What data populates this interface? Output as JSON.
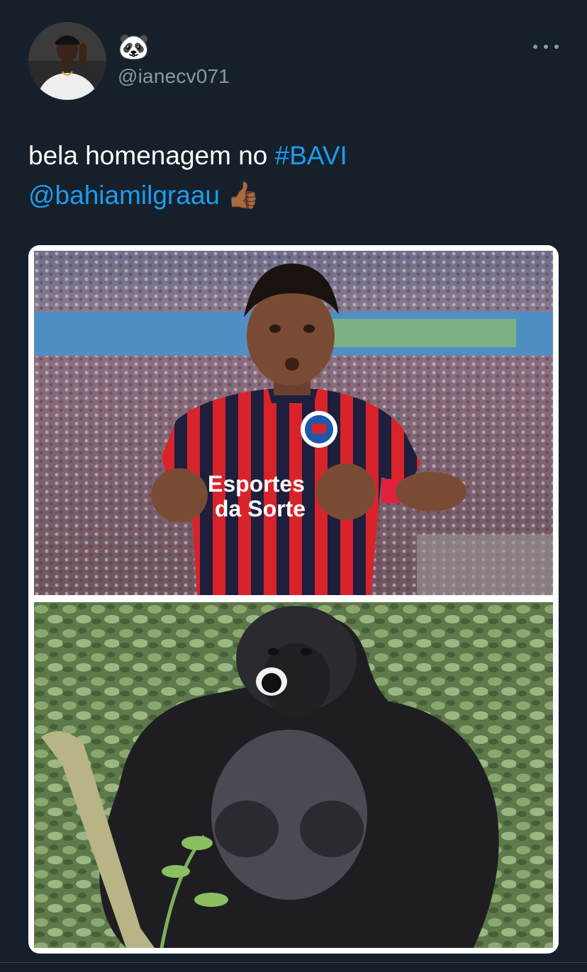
{
  "tweet": {
    "author": {
      "display_name": "🐼",
      "handle": "@ianecv071",
      "avatar_icon": "user-avatar-photo"
    },
    "more_icon": "more-options-icon",
    "text": {
      "plain": "bela homenagem no ",
      "hashtag": "#BAVI",
      "mention": "@bahiamilgraau",
      "emoji": "👍🏾"
    },
    "media": [
      {
        "description_icon": "photo-footballer",
        "jersey_sponsor_line1": "Esportes",
        "jersey_sponsor_line2": "da Sorte"
      },
      {
        "description_icon": "photo-gorilla"
      }
    ]
  },
  "colors": {
    "background": "#15202b",
    "link": "#1d9bf0",
    "secondary_text": "#8b98a5"
  }
}
